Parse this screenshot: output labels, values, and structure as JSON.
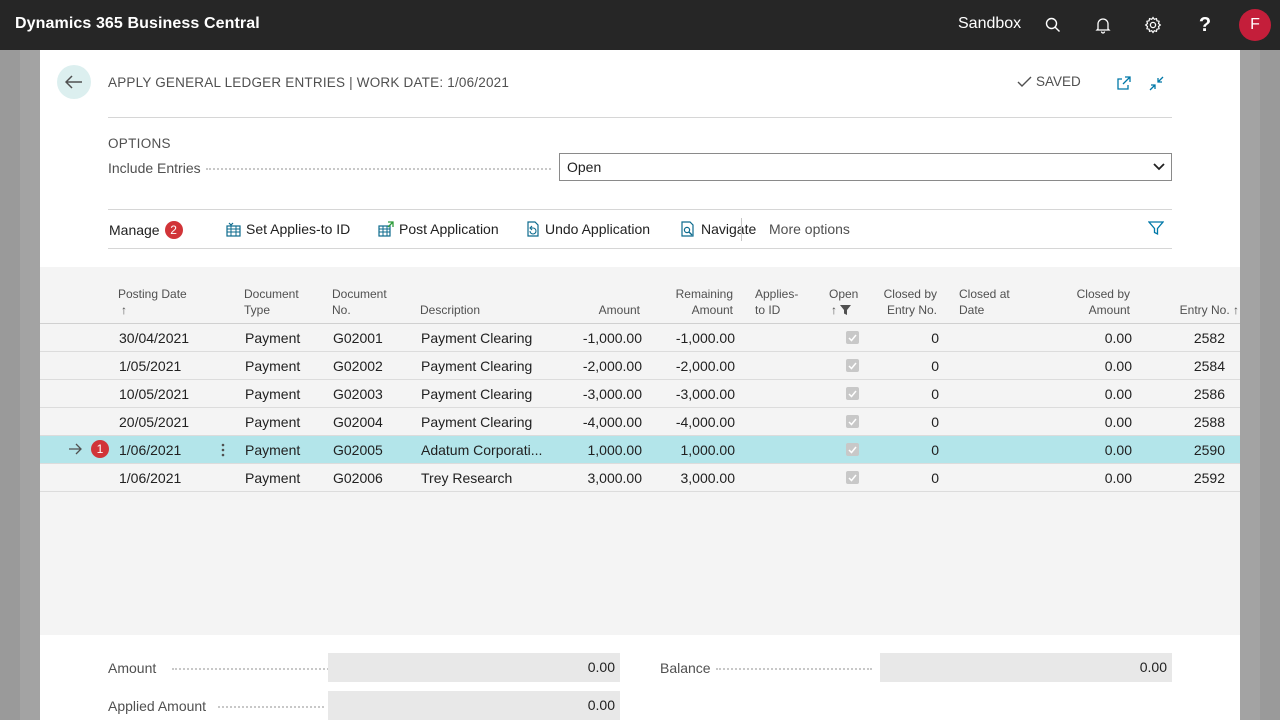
{
  "topbar": {
    "app_title": "Dynamics 365 Business Central",
    "environment": "Sandbox",
    "avatar_initial": "F"
  },
  "header": {
    "title": "APPLY GENERAL LEDGER ENTRIES | WORK DATE: 1/06/2021",
    "saved_label": "SAVED"
  },
  "options": {
    "caption": "OPTIONS",
    "include_entries_label": "Include Entries",
    "include_entries_value": "Open"
  },
  "actions": {
    "manage": "Manage",
    "set_applies_to_id": "Set Applies-to ID",
    "post_application": "Post Application",
    "undo_application": "Undo Application",
    "navigate": "Navigate",
    "more_options": "More options",
    "manage_badge": "2"
  },
  "grid": {
    "headers": {
      "posting_date": "Posting Date",
      "document_type_1": "Document",
      "document_type_2": "Type",
      "document_no_1": "Document",
      "document_no_2": "No.",
      "description": "Description",
      "amount": "Amount",
      "remaining_1": "Remaining",
      "remaining_2": "Amount",
      "applies_to_1": "Applies-",
      "applies_to_2": "to ID",
      "open": "Open",
      "closed_by_entry_1": "Closed by",
      "closed_by_entry_2": "Entry No.",
      "closed_at_1": "Closed at",
      "closed_at_2": "Date",
      "closed_by_amount_1": "Closed by",
      "closed_by_amount_2": "Amount",
      "entry_no": "Entry No."
    },
    "selected_badge": "1",
    "rows": [
      {
        "posting_date": "30/04/2021",
        "doc_type": "Payment",
        "doc_no": "G02001",
        "description": "Payment Clearing",
        "amount": "-1,000.00",
        "remaining": "-1,000.00",
        "closed_by_entry": "0",
        "closed_by_amount": "0.00",
        "entry_no": "2582"
      },
      {
        "posting_date": "1/05/2021",
        "doc_type": "Payment",
        "doc_no": "G02002",
        "description": "Payment Clearing",
        "amount": "-2,000.00",
        "remaining": "-2,000.00",
        "closed_by_entry": "0",
        "closed_by_amount": "0.00",
        "entry_no": "2584"
      },
      {
        "posting_date": "10/05/2021",
        "doc_type": "Payment",
        "doc_no": "G02003",
        "description": "Payment Clearing",
        "amount": "-3,000.00",
        "remaining": "-3,000.00",
        "closed_by_entry": "0",
        "closed_by_amount": "0.00",
        "entry_no": "2586"
      },
      {
        "posting_date": "20/05/2021",
        "doc_type": "Payment",
        "doc_no": "G02004",
        "description": "Payment Clearing",
        "amount": "-4,000.00",
        "remaining": "-4,000.00",
        "closed_by_entry": "0",
        "closed_by_amount": "0.00",
        "entry_no": "2588"
      },
      {
        "posting_date": "1/06/2021",
        "doc_type": "Payment",
        "doc_no": "G02005",
        "description": "Adatum Corporati...",
        "amount": "1,000.00",
        "remaining": "1,000.00",
        "closed_by_entry": "0",
        "closed_by_amount": "0.00",
        "entry_no": "2590"
      },
      {
        "posting_date": "1/06/2021",
        "doc_type": "Payment",
        "doc_no": "G02006",
        "description": "Trey Research",
        "amount": "3,000.00",
        "remaining": "3,000.00",
        "closed_by_entry": "0",
        "closed_by_amount": "0.00",
        "entry_no": "2592"
      }
    ]
  },
  "totals": {
    "amount_label": "Amount",
    "amount_value": "0.00",
    "balance_label": "Balance",
    "balance_value": "0.00",
    "applied_amount_label": "Applied Amount",
    "applied_amount_value": "0.00"
  },
  "colors": {
    "topbar": "#262626",
    "accent": "#008489",
    "selected_row": "#b3e5ea",
    "badge": "#d13438",
    "avatar": "#c41e3a"
  },
  "icons": [
    "search-icon",
    "bell-icon",
    "gear-icon",
    "help-icon",
    "back-arrow-icon",
    "checkmark-icon",
    "open-in-new-window-icon",
    "collapse-icon",
    "filter-icon"
  ]
}
